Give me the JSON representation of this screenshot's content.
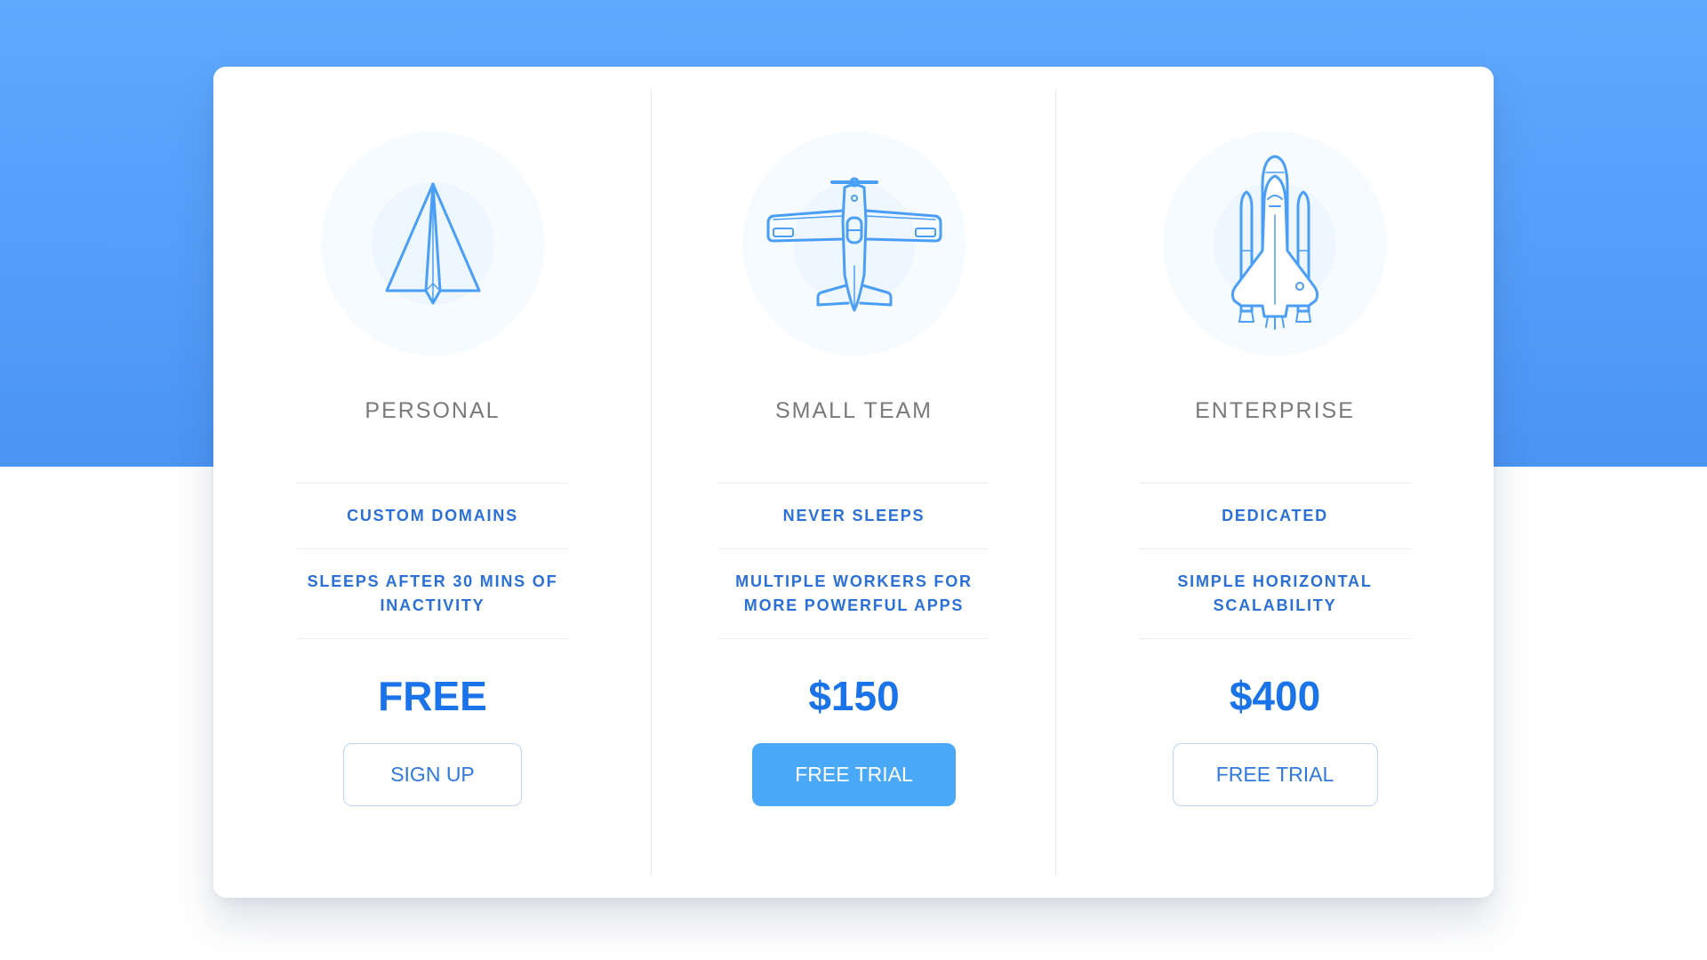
{
  "colors": {
    "hero_top": "#60a9ff",
    "hero_bottom": "#4b94f3",
    "accent": "#1a73e8",
    "feature_text": "#2a70d8",
    "plan_name_text": "#7a7a7a",
    "icon_stroke": "#4a9ef5",
    "primary_button": "#4aa8f9"
  },
  "plans": [
    {
      "name": "PERSONAL",
      "icon": "paper-plane-icon",
      "features": [
        "CUSTOM DOMAINS",
        "SLEEPS AFTER 30 MINS OF INACTIVITY"
      ],
      "price": "FREE",
      "button_label": "SIGN UP",
      "button_style": "outline"
    },
    {
      "name": "SMALL TEAM",
      "icon": "airplane-icon",
      "features": [
        "NEVER SLEEPS",
        "MULTIPLE WORKERS FOR MORE POWERFUL APPS"
      ],
      "price": "$150",
      "button_label": "FREE TRIAL",
      "button_style": "filled"
    },
    {
      "name": "ENTERPRISE",
      "icon": "space-shuttle-icon",
      "features": [
        "DEDICATED",
        "SIMPLE HORIZONTAL SCALABILITY"
      ],
      "price": "$400",
      "button_label": "FREE TRIAL",
      "button_style": "outline"
    }
  ]
}
